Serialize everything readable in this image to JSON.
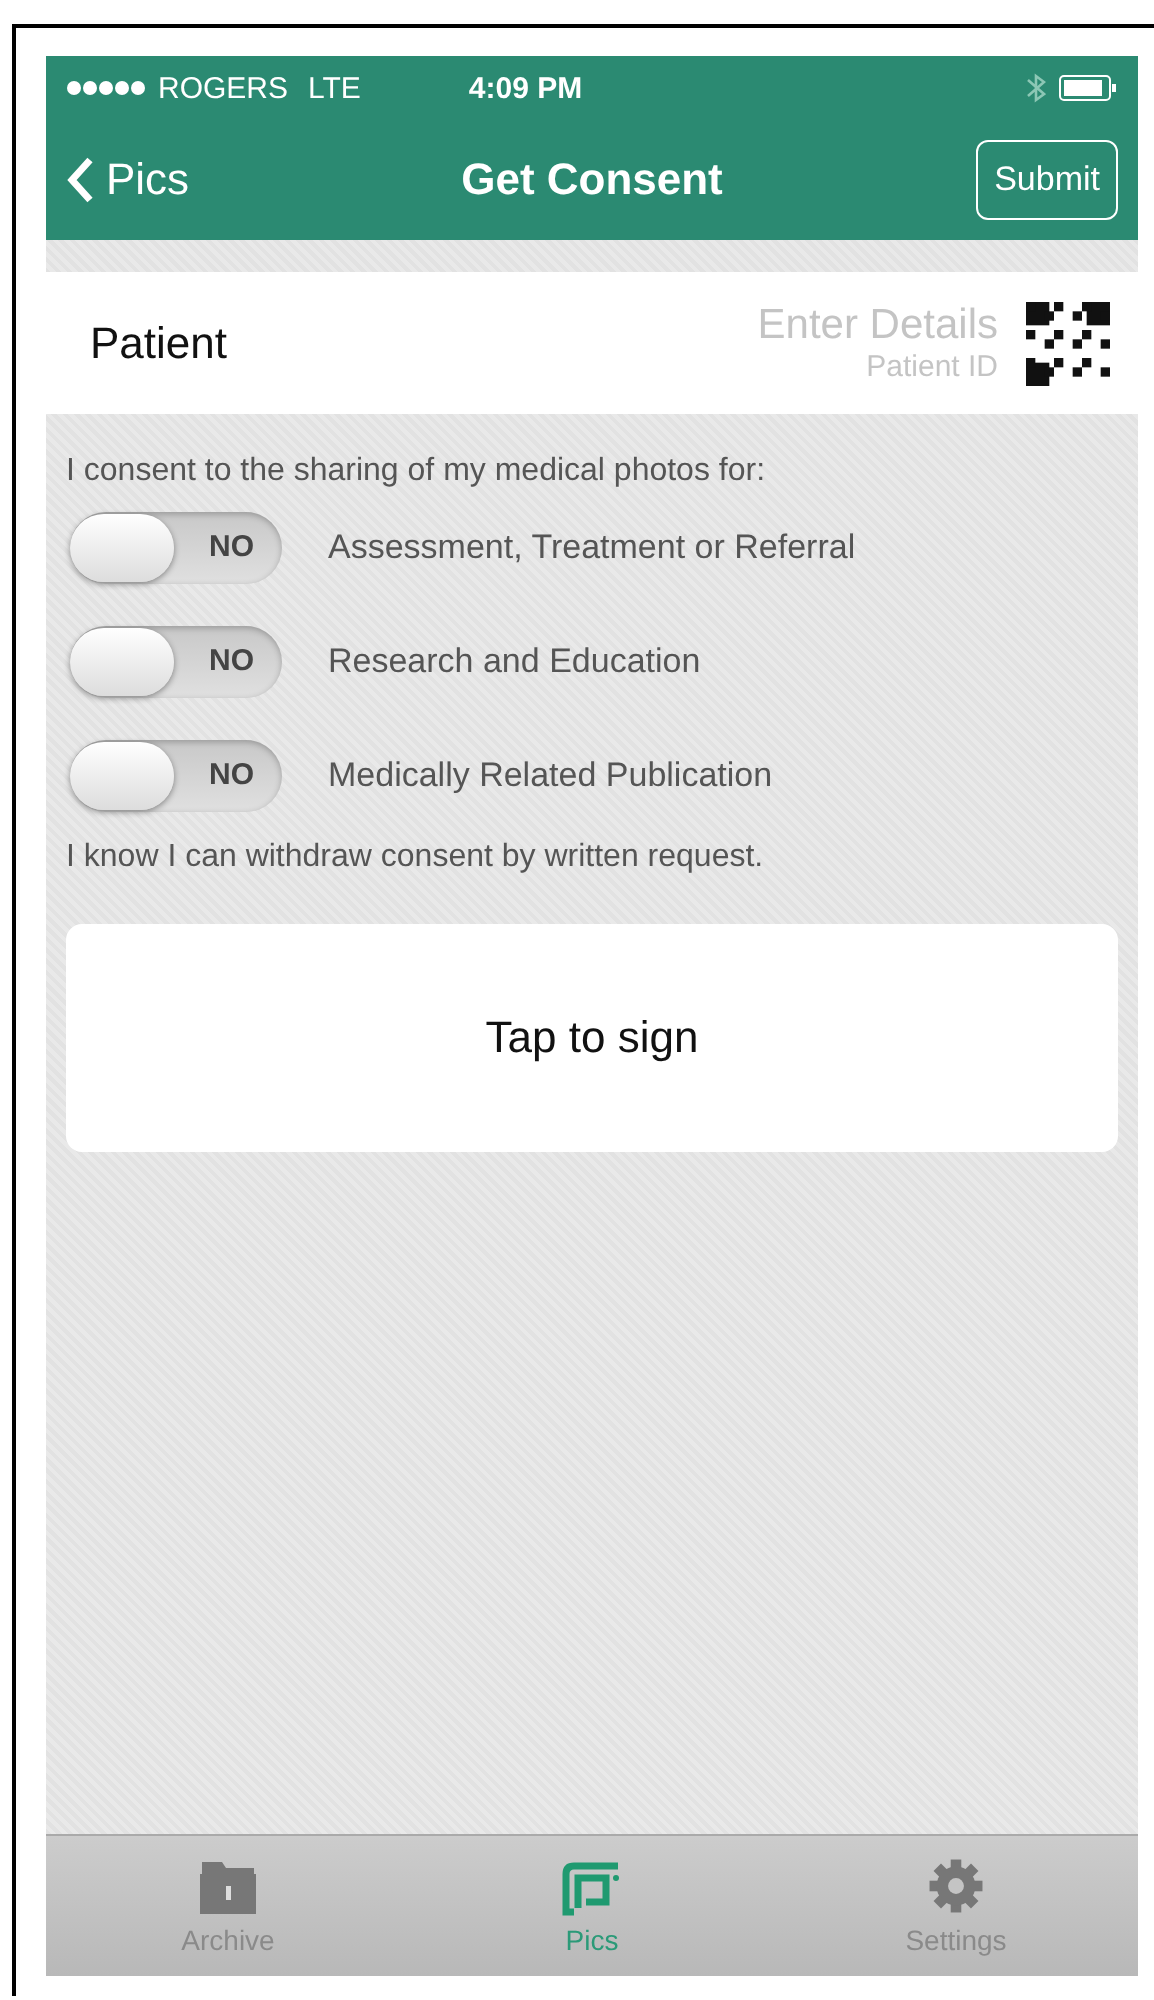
{
  "status_bar": {
    "carrier": "ROGERS",
    "network": "LTE",
    "time": "4:09 PM"
  },
  "nav": {
    "back": "Pics",
    "title": "Get Consent",
    "action": "Submit"
  },
  "patient": {
    "label": "Patient",
    "placeholder": "Enter Details",
    "sublabel": "Patient ID"
  },
  "intro": "I consent to the sharing of my medical photos for:",
  "options": [
    {
      "label": "Assessment, Treatment or Referral",
      "switch_text": "NO",
      "on": false
    },
    {
      "label": "Research and Education",
      "switch_text": "NO",
      "on": false
    },
    {
      "label": "Medically Related Publication",
      "switch_text": "NO",
      "on": false
    }
  ],
  "note": "I know I can withdraw consent by written request.",
  "sign": "Tap to sign",
  "tabs": [
    {
      "label": "Archive",
      "kind": "archive",
      "selected": false
    },
    {
      "label": "Pics",
      "kind": "pics",
      "selected": true
    },
    {
      "label": "Settings",
      "kind": "settings",
      "selected": false
    }
  ]
}
